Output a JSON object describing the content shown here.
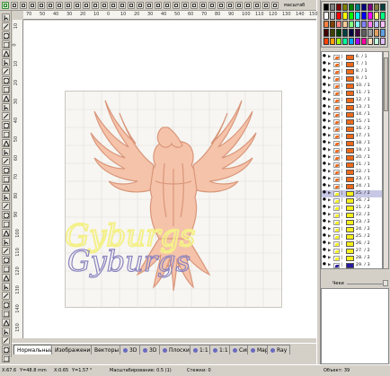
{
  "top_toolbar": {
    "zoom_hint": "масштаб",
    "buttons": [
      "new-document",
      "open",
      "save",
      "print",
      "cut",
      "copy",
      "paste",
      "undo",
      "redo",
      "select",
      "node",
      "zoom",
      "pan",
      "rotate",
      "mirror",
      "align",
      "group",
      "ungroup",
      "weld",
      "trim",
      "order",
      "contour",
      "fill",
      "gradient",
      "text",
      "shape",
      "measure",
      "grid",
      "snap",
      "settings",
      "help"
    ]
  },
  "ruler_top": {
    "ticks": [
      "70",
      "50",
      "40",
      "30",
      "20",
      "10",
      "0",
      "10",
      "20",
      "30",
      "40",
      "50",
      "60",
      "70",
      "80",
      "90",
      "100",
      "110",
      "120",
      "130",
      "140",
      "150"
    ]
  },
  "ruler_left": {
    "ticks": [
      "10",
      "0",
      "10",
      "20",
      "30",
      "40",
      "50",
      "60",
      "70",
      "80",
      "90",
      "100",
      "110",
      "120",
      "130",
      "140",
      "150"
    ]
  },
  "colors": {
    "eagle_fill": "#f5c3aa",
    "eagle_stroke": "#d9967a",
    "text_yellow": "#f4f08a",
    "text_purple": "#b2acd8",
    "text_purple_stroke": "#8a83c0",
    "grid_line": "#e0dfdb",
    "selected_layer": "#c8c8e6"
  },
  "canvas_text": {
    "artwork_word": "Gyburgs"
  },
  "bottom_tabs": [
    {
      "label": "Нормальный",
      "active": true
    },
    {
      "label": "Изображение"
    },
    {
      "label": "Векторы"
    },
    {
      "label": "3D"
    },
    {
      "label": "3D"
    },
    {
      "label": "Плоский"
    },
    {
      "label": "1:1"
    },
    {
      "label": "1:1"
    },
    {
      "label": "Син"
    },
    {
      "label": "Мар"
    },
    {
      "label": "Ray"
    }
  ],
  "status_bar": {
    "x_coord": "X:67.6",
    "y_coord": "Y=48.8 mm",
    "x2": "X:0.65",
    "y2": "Y=1.57 °",
    "scale": "Масштабирование: 0.5 (1)",
    "stitches": "Стежки: 0",
    "objects": "Объект: 39"
  },
  "palette": {
    "swatches": [
      "#000000",
      "#808080",
      "#800000",
      "#808000",
      "#008000",
      "#008080",
      "#000080",
      "#800080",
      "#808040",
      "#004040",
      "#ffffff",
      "#c0c0c0",
      "#ff0000",
      "#ffff00",
      "#00ff00",
      "#00ffff",
      "#0000ff",
      "#ff00ff",
      "#ffff80",
      "#00ff80",
      "#ff8040",
      "#804000",
      "#ff8080",
      "#ffcc99",
      "#80ff80",
      "#80ffff",
      "#8080ff",
      "#ff80ff",
      "#c0c0ff",
      "#ffc0ff",
      "#400000",
      "#404000",
      "#004000",
      "#003f3f",
      "#000040",
      "#400040",
      "#606060",
      "#a0a0a0",
      "#e0a060",
      "#60a0e0",
      "#ff4000",
      "#ffa000",
      "#a0ff00",
      "#00ffa0",
      "#00a0ff",
      "#a000ff",
      "#ff00a0",
      "#ffe0c0",
      "#c0ffe0",
      "#e0c0ff"
    ]
  },
  "layers": [
    {
      "name": "6. / 1",
      "color": "#ee6a1a"
    },
    {
      "name": "7. / 1",
      "color": "#ee6a1a"
    },
    {
      "name": "8. / 1",
      "color": "#ee6a1a"
    },
    {
      "name": "9. / 1",
      "color": "#ee6a1a"
    },
    {
      "name": "10. / 1",
      "color": "#ee6a1a"
    },
    {
      "name": "11. / 1",
      "color": "#ee6a1a"
    },
    {
      "name": "12. / 1",
      "color": "#ee6a1a"
    },
    {
      "name": "13. / 1",
      "color": "#ee6a1a"
    },
    {
      "name": "14. / 1",
      "color": "#ee6a1a"
    },
    {
      "name": "15. / 1",
      "color": "#ee6a1a"
    },
    {
      "name": "16. / 1",
      "color": "#ee6a1a"
    },
    {
      "name": "17. / 1",
      "color": "#ee6a1a"
    },
    {
      "name": "18. / 1",
      "color": "#ee6a1a"
    },
    {
      "name": "19. / 1",
      "color": "#ee6a1a"
    },
    {
      "name": "20. / 1",
      "color": "#ee6a1a"
    },
    {
      "name": "21. / 1",
      "color": "#ee6a1a"
    },
    {
      "name": "22. / 1",
      "color": "#ee6a1a"
    },
    {
      "name": "23. / 1",
      "color": "#ee6a1a"
    },
    {
      "name": "24. / 1",
      "color": "#ee6a1a"
    },
    {
      "name": "25. / 2",
      "color": "#f6f01c",
      "selected": true
    },
    {
      "name": "26. / 2",
      "color": "#f6f01c"
    },
    {
      "name": "21. / 2",
      "color": "#f6f01c"
    },
    {
      "name": "22. / 2",
      "color": "#f6f01c"
    },
    {
      "name": "23. / 2",
      "color": "#f6f01c"
    },
    {
      "name": "24. / 2",
      "color": "#f6f01c"
    },
    {
      "name": "25. / 2",
      "color": "#f6f01c"
    },
    {
      "name": "26. / 2",
      "color": "#f6f01c"
    },
    {
      "name": "27. / 2",
      "color": "#f6f01c"
    },
    {
      "name": "28. / 2",
      "color": "#f6f01c"
    },
    {
      "name": "29. / 3",
      "color": "#2a1aa0"
    }
  ],
  "layer_panel": {
    "chek_label": "Чеки"
  }
}
